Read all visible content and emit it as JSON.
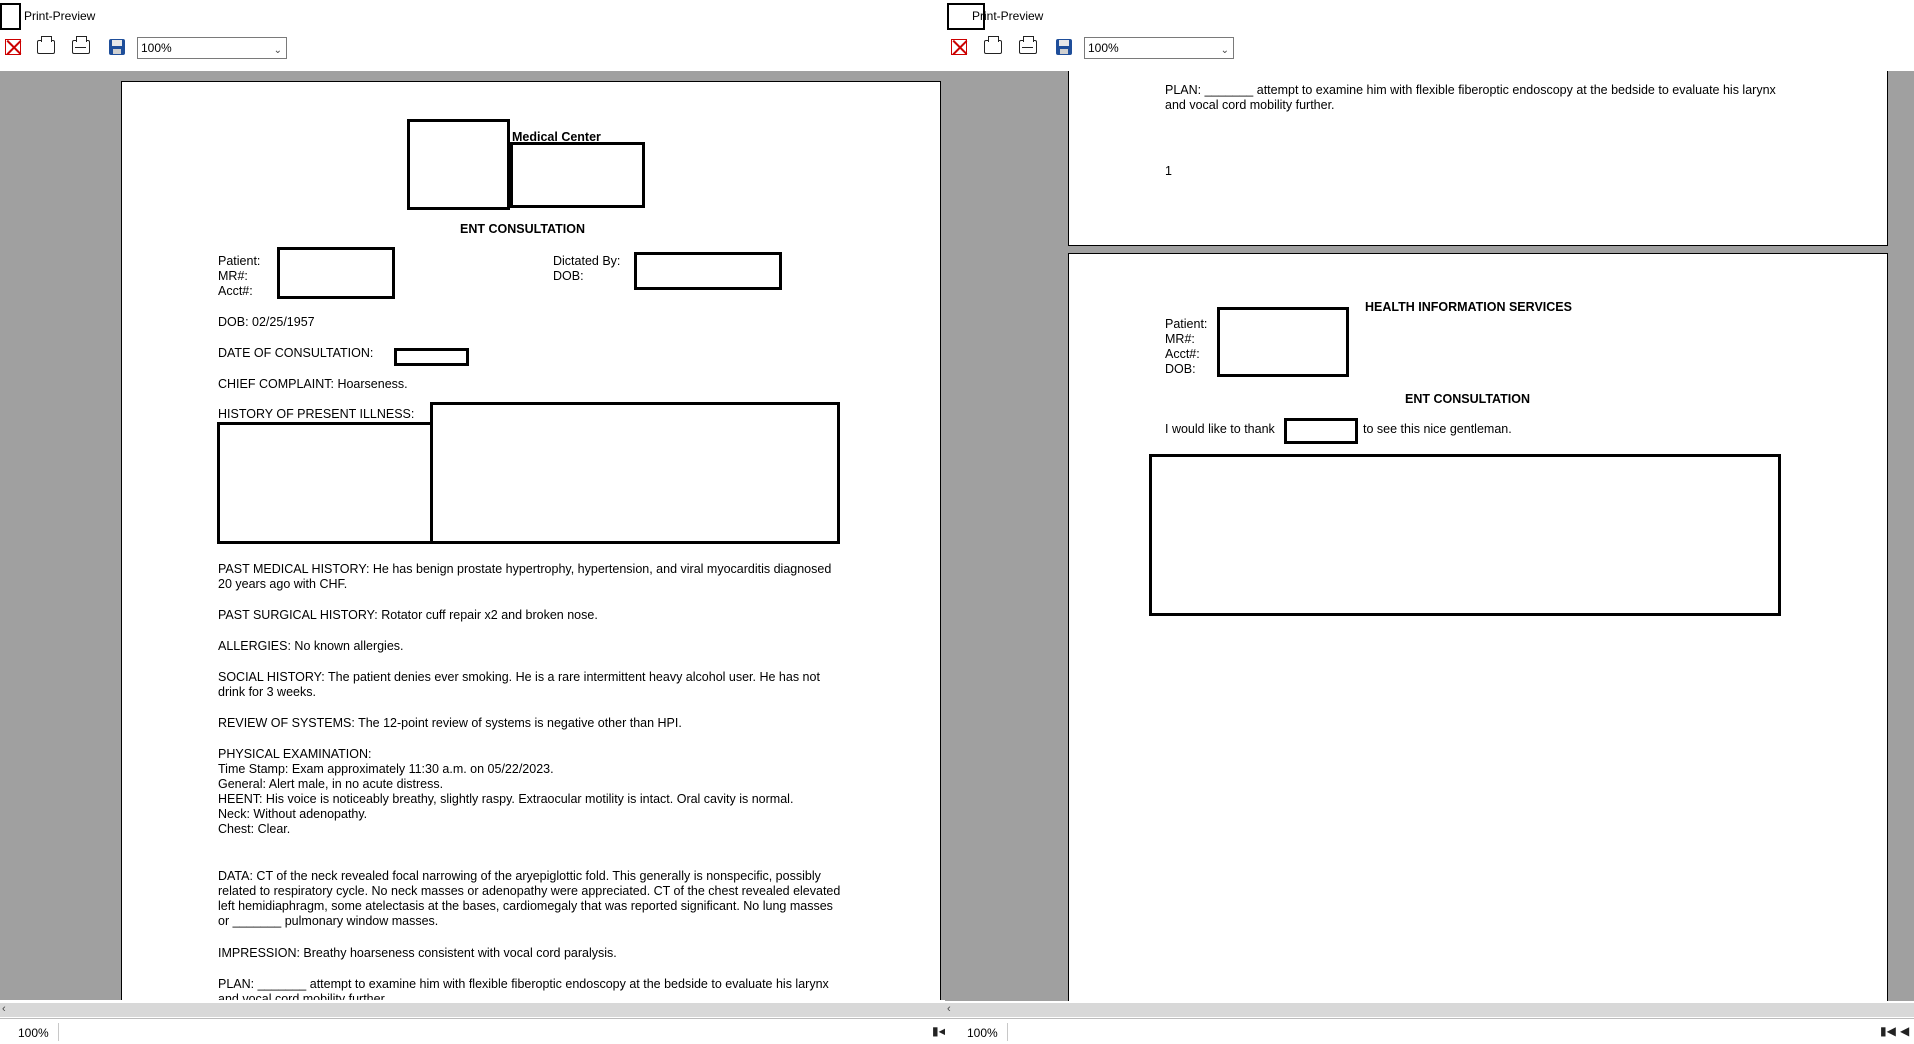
{
  "window": {
    "title": "Print-Preview",
    "zoom_value": "100%"
  },
  "toolbar": {
    "close_icon": "close-icon",
    "print_icon": "print-icon",
    "print_setup_icon": "print-setup-icon",
    "save_icon": "save-icon",
    "zoom_options": [
      "100%"
    ]
  },
  "status": {
    "zoom": "100%"
  },
  "colors": {
    "background": "#a0a0a0",
    "page": "#ffffff",
    "accent_close": "#cc0000",
    "save_icon": "#1f4e9a"
  },
  "doc_left": {
    "header_org": "Medical Center",
    "section_title": "ENT CONSULTATION",
    "patient_label": "Patient:",
    "mr_label": "MR#:",
    "acct_label": "Acct#:",
    "dictated_by_label": "Dictated By:",
    "dob_label": "DOB:",
    "dob_line": "DOB:  02/25/1957",
    "date_consult_label": "DATE OF CONSULTATION:",
    "chief_complaint": "CHIEF COMPLAINT:  Hoarseness.",
    "hpi_label": "HISTORY OF PRESENT ILLNESS:",
    "past_medical": "PAST MEDICAL HISTORY:  He has benign prostate hypertrophy, hypertension, and viral myocarditis diagnosed 20 years ago with CHF.",
    "past_surgical": "PAST SURGICAL HISTORY:  Rotator cuff repair x2 and broken nose.",
    "allergies": "ALLERGIES:  No known allergies.",
    "social": "SOCIAL HISTORY:  The patient denies ever smoking.  He is a rare intermittent heavy alcohol user.  He has not drink for 3 weeks.",
    "ros": "REVIEW OF SYSTEMS:  The 12-point review of systems is negative other than HPI.",
    "pe_lines": [
      "PHYSICAL EXAMINATION:",
      "Time Stamp:  Exam approximately 11:30 a.m. on 05/22/2023.",
      "General:  Alert male, in no acute distress.",
      "HEENT:  His voice is noticeably breathy, slightly raspy.  Extraocular motility is intact.  Oral cavity is normal.",
      "Neck:  Without adenopathy.",
      "Chest:  Clear."
    ],
    "data": "DATA:  CT of the neck revealed focal narrowing of the aryepiglottic fold.  This generally is nonspecific, possibly related to respiratory cycle.  No neck masses or adenopathy were appreciated.  CT of the chest revealed elevated left hemidiaphragm, some atelectasis at the bases, cardiomegaly that was reported significant.  No lung masses or _______ pulmonary window masses.",
    "impression": "IMPRESSION:  Breathy hoarseness consistent with vocal cord paralysis.",
    "plan": "PLAN:  _______ attempt to examine him with flexible fiberoptic endoscopy at the bedside to evaluate his larynx and vocal cord mobility further."
  },
  "doc_right": {
    "plan": "PLAN:  _______ attempt to examine him with flexible fiberoptic endoscopy at the bedside to evaluate his larynx and vocal cord mobility further.",
    "page_number": "1",
    "his_title": "HEALTH INFORMATION SERVICES",
    "patient_label": "Patient:",
    "mr_label": "MR#:",
    "acct_label": "Acct#:",
    "dob_label": "DOB:",
    "section_title": "ENT CONSULTATION",
    "thank_prefix": "I would like to thank",
    "thank_suffix": "to see this nice gentleman."
  }
}
